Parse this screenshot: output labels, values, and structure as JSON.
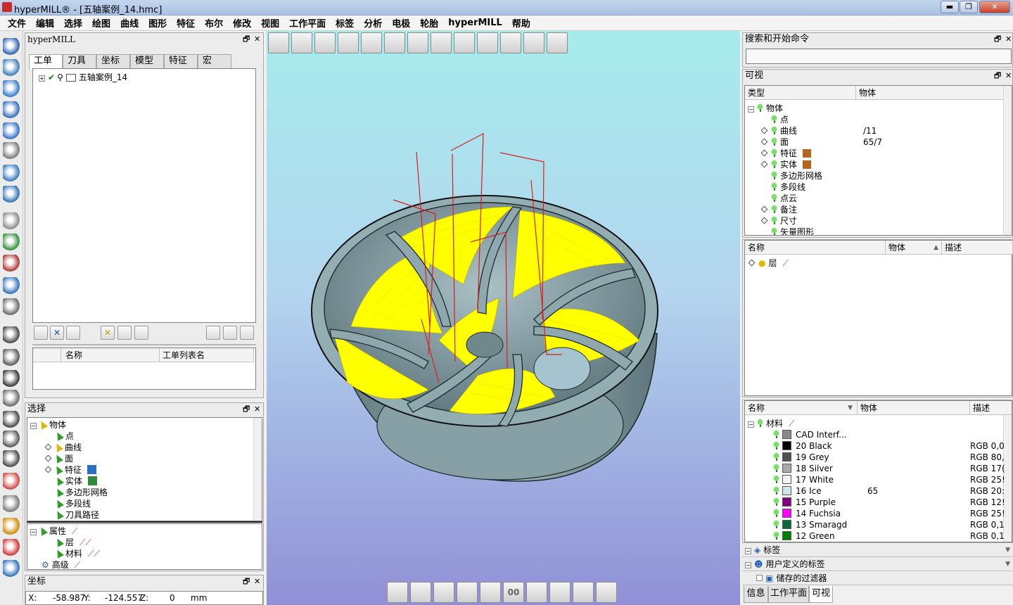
{
  "window": {
    "title": "hyperMILL® - [五轴案例_14.hmc]",
    "min": "▬",
    "restore": "❐",
    "close": "✕"
  },
  "menu": [
    "文件",
    "编辑",
    "选择",
    "绘图",
    "曲线",
    "图形",
    "特征",
    "布尔",
    "修改",
    "视图",
    "工作平面",
    "标签",
    "分析",
    "电极",
    "轮胎",
    "hyperMILL",
    "帮助"
  ],
  "hm_panel": {
    "title": "hyperMILL",
    "tabs": [
      "工单",
      "刀具",
      "坐标",
      "模型",
      "特征",
      "宏"
    ],
    "active_tab": "工单",
    "tree_item": "五轴案例_14",
    "list_cols": [
      "名称",
      "工单列表名"
    ]
  },
  "select_panel": {
    "title": "选择",
    "root": "物体",
    "items": [
      "点",
      "曲线",
      "面",
      "特征",
      "实体",
      "多边形网格",
      "多段线",
      "刀具路径"
    ],
    "attr_root": "属性",
    "attr_items": [
      "层",
      "材料"
    ],
    "advanced": "高级"
  },
  "coord_panel": {
    "title": "坐标",
    "x_label": "X:",
    "x": "-58.987",
    "y_label": "Y:",
    "y": "-124.557",
    "z_label": "Z:",
    "z": "0",
    "unit": "mm"
  },
  "search_panel": {
    "title": "搜索和开始命令",
    "value": ""
  },
  "visible_panel": {
    "title": "可视",
    "cols": [
      "类型",
      "物体"
    ],
    "root": "物体",
    "rows": [
      {
        "label": "点",
        "count": ""
      },
      {
        "label": "曲线",
        "count": "/11"
      },
      {
        "label": "面",
        "count": "65/7"
      },
      {
        "label": "特征",
        "count": ""
      },
      {
        "label": "实体",
        "count": ""
      },
      {
        "label": "多边形网格",
        "count": ""
      },
      {
        "label": "多段线",
        "count": ""
      },
      {
        "label": "点云",
        "count": ""
      },
      {
        "label": "备注",
        "count": ""
      },
      {
        "label": "尺寸",
        "count": ""
      },
      {
        "label": "矢量图形",
        "count": ""
      }
    ]
  },
  "layers_panel": {
    "cols": [
      "名称",
      "物体",
      "描述"
    ],
    "sort_mark": "▲",
    "row": "层"
  },
  "material_panel": {
    "cols": [
      "名称",
      "物体",
      "描述"
    ],
    "sort_mark": "▼",
    "root": "材料",
    "rows": [
      {
        "name": "CAD Interf...",
        "count": "",
        "desc": "",
        "color": "#8a8a8a"
      },
      {
        "name": "20 Black",
        "count": "",
        "desc": "RGB 0,0",
        "color": "#000000"
      },
      {
        "name": "19 Grey",
        "count": "",
        "desc": "RGB 80,",
        "color": "#505050"
      },
      {
        "name": "18 Silver",
        "count": "",
        "desc": "RGB 17(",
        "color": "#aaaaaa"
      },
      {
        "name": "17 White",
        "count": "",
        "desc": "RGB 25!",
        "color": "#f4f4f4"
      },
      {
        "name": "16 Ice",
        "count": "65",
        "desc": "RGB 20:",
        "color": "#cfe6ee"
      },
      {
        "name": "15 Purple",
        "count": "",
        "desc": "RGB 12!",
        "color": "#800080"
      },
      {
        "name": "14 Fuchsia",
        "count": "",
        "desc": "RGB 25!",
        "color": "#ff00ff"
      },
      {
        "name": "13 Smaragd",
        "count": "",
        "desc": "RGB 0,1",
        "color": "#0a6a3a"
      },
      {
        "name": "12 Green",
        "count": "",
        "desc": "RGB 0,1",
        "color": "#008000"
      }
    ]
  },
  "right_sections": [
    "标签",
    "用户定义的标签",
    "储存的过滤器"
  ],
  "right_tabs": [
    "信息",
    "工作平面",
    "可视"
  ],
  "active_right_tab": "可视",
  "bottom_toolbar_label": "00",
  "colors": {
    "toolpath": "#ffff00",
    "path_lines": "#d81e1e",
    "part": "#8fa8ad"
  }
}
